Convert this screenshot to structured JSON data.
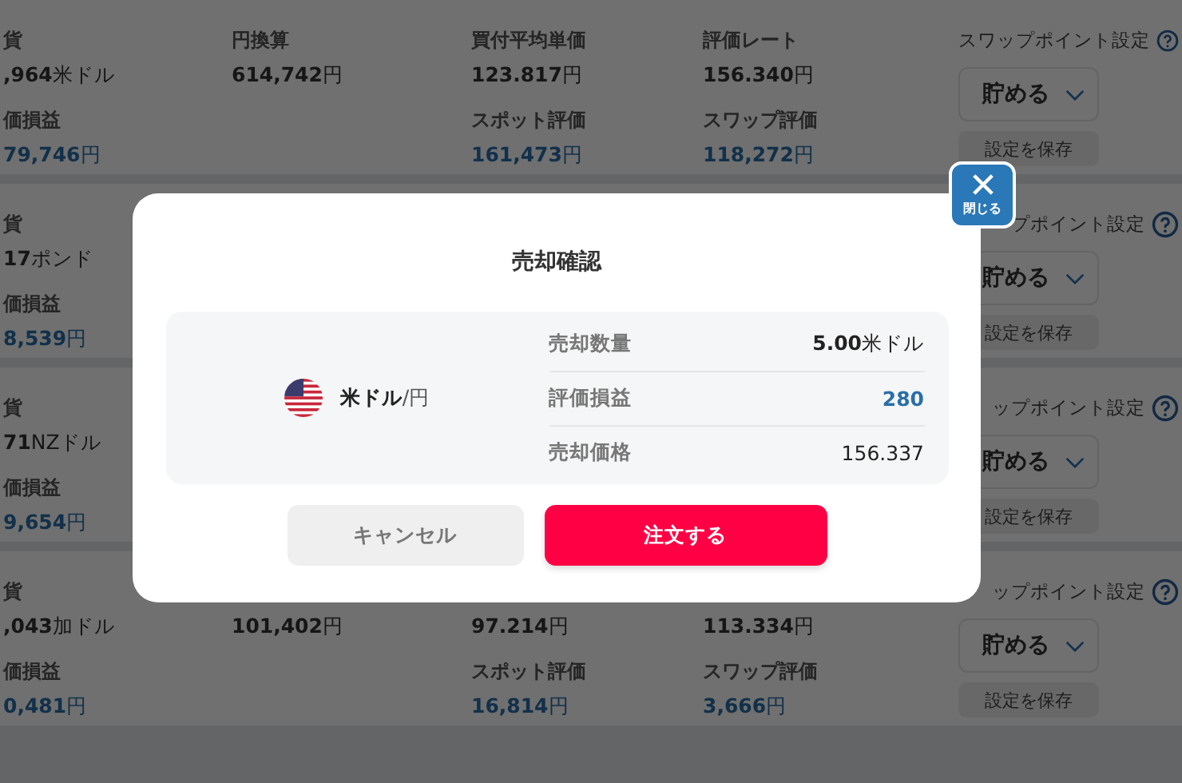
{
  "positions": [
    {
      "columns": [
        [
          {
            "label": "貨",
            "value": "**,964**米ドル",
            "kind": "plain"
          },
          {
            "label": "価損益",
            "value": "**79,746**円",
            "kind": "pnl"
          }
        ],
        [
          {
            "label": "円換算",
            "value": "**614,742**円",
            "kind": "plain"
          }
        ],
        [
          {
            "label": "買付平均単価",
            "value": "**123.817**円",
            "kind": "plain"
          },
          {
            "label": "スポット評価",
            "value": "**161,473**円",
            "kind": "pnl"
          }
        ],
        [
          {
            "label": "評価レート",
            "value": "**156.340**円",
            "kind": "plain"
          },
          {
            "label": "スワップ評価",
            "value": "**118,272**円",
            "kind": "pnl"
          }
        ]
      ],
      "swap": {
        "label": "スワップポイント設定",
        "select": "貯める",
        "save": "設定を保存",
        "disabled": true
      }
    },
    {
      "columns": [
        [
          {
            "label": "貨",
            "value": "**17**ポンド",
            "kind": "plain"
          },
          {
            "label": "価損益",
            "value": "**8,539**円",
            "kind": "pnl"
          }
        ]
      ],
      "swap": {
        "label": "プポイント設定",
        "select": "貯める",
        "save": "設定を保存",
        "disabled": true
      }
    },
    {
      "columns": [
        [
          {
            "label": "貨",
            "value": "**71**NZドル",
            "kind": "plain"
          },
          {
            "label": "価損益",
            "value": "**9,654**円",
            "kind": "pnl"
          }
        ]
      ],
      "swap": {
        "label": "ップポイント設定",
        "select": "貯める",
        "save": "設定を保存",
        "disabled": true
      }
    },
    {
      "columns": [
        [
          {
            "label": "貨",
            "value": "**,043**加ドル",
            "kind": "plain"
          },
          {
            "label": "価損益",
            "value": "**0,481**円",
            "kind": "pnl"
          }
        ],
        [
          {
            "value": "**101,402**円",
            "kind": "plain"
          }
        ],
        [
          {
            "value": "**97.214**円",
            "kind": "plain"
          },
          {
            "label": "スポット評価",
            "value": "**16,814**円",
            "kind": "pnl"
          }
        ],
        [
          {
            "value": "**113.334**円",
            "kind": "plain"
          },
          {
            "label": "スワップ評価",
            "value": "**3,666**円",
            "kind": "pnl"
          }
        ]
      ],
      "swap": {
        "label": "ップポイント設定",
        "select": "貯める",
        "save": "設定を保存",
        "disabled": true
      }
    }
  ],
  "dialog": {
    "title": "売却確認",
    "close": "閉じる",
    "pair": "**米ドル**/円",
    "rows": [
      {
        "label": "売却数量",
        "value": "**5.00**米ドル",
        "kind": "plain"
      },
      {
        "label": "評価損益",
        "value": "280",
        "kind": "pnl"
      },
      {
        "label": "売却価格",
        "value": "156.337",
        "kind": "plain"
      }
    ],
    "buttons": [
      {
        "label": "キャンセル",
        "kind": "cancel"
      },
      {
        "label": "注文する",
        "kind": "primary"
      }
    ]
  }
}
